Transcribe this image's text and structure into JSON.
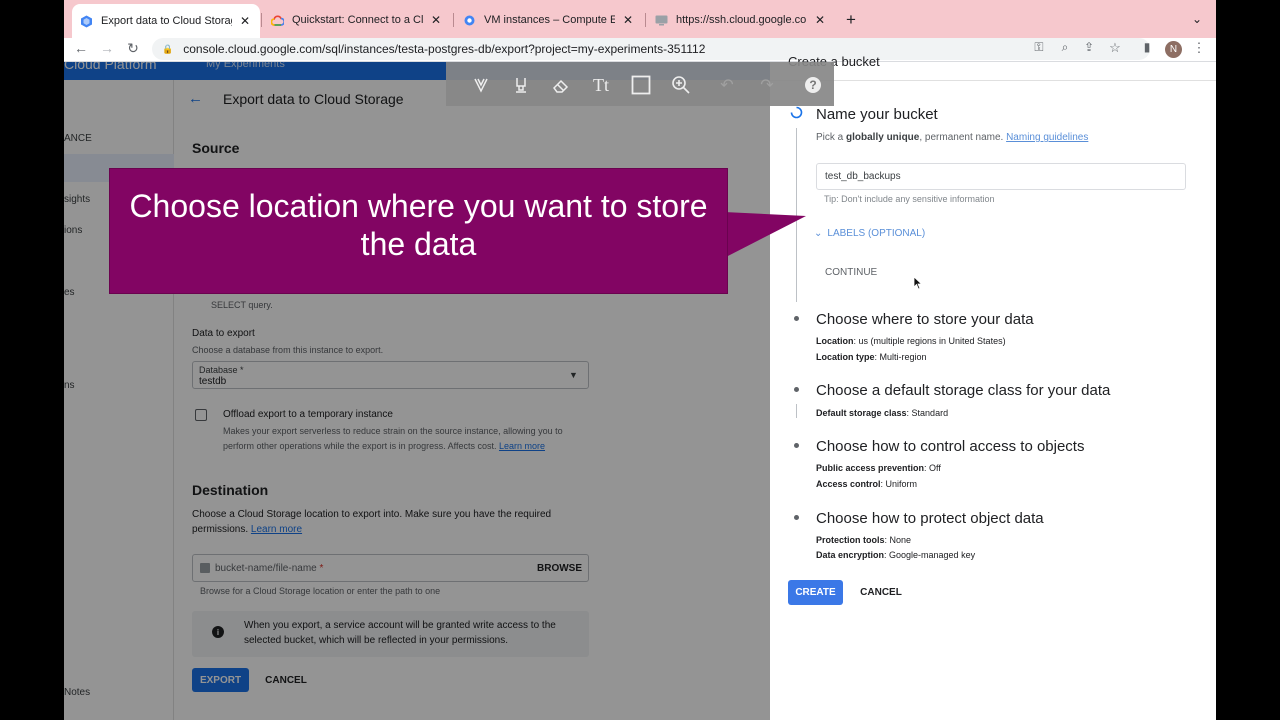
{
  "browser": {
    "tabs": [
      {
        "title": "Export data to Cloud Storage –",
        "icon": "cloud-sql-icon",
        "active": true
      },
      {
        "title": "Quickstart: Connect to a Cloud",
        "icon": "google-cloud-icon",
        "active": false
      },
      {
        "title": "VM instances – Compute Engi",
        "icon": "compute-engine-icon",
        "active": false
      },
      {
        "title": "https://ssh.cloud.google.com/v",
        "icon": "ssh-icon",
        "active": false
      }
    ],
    "new_tab": "+",
    "url": "console.cloud.google.com/sql/instances/testa-postgres-db/export?project=my-experiments-351112",
    "profile_initial": "N"
  },
  "left": {
    "page_title": "Export data to Cloud Storage",
    "header_brand": "Cloud Platform",
    "header_project": "My Experiments",
    "sidenav": [
      "ANCE",
      "sights",
      "ions",
      "es",
      "ns",
      "Notes"
    ],
    "source_heading": "Source",
    "select_query_note": "SELECT query.",
    "data_to_export_label": "Data to export",
    "data_to_export_help": "Choose a database from this instance to export.",
    "database_label": "Database *",
    "database_value": "testdb",
    "offload_label": "Offload export to a temporary instance",
    "offload_help": "Makes your export serverless to reduce strain on the source instance, allowing you to",
    "offload_help2": "perform other operations while the export is in progress. Affects cost.",
    "learn_more": "Learn more",
    "destination_heading": "Destination",
    "destination_help": "Choose a Cloud Storage location to export into. Make sure you have the required",
    "destination_help2": "permissions.",
    "bucket_placeholder": "bucket-name/file-name",
    "browse_label": "BROWSE",
    "bucket_help": "Browse for a Cloud Storage location or enter the path to one",
    "info_text": "When you export, a service account will be granted write access to the",
    "info_text2": "selected bucket, which will be reflected in your permissions.",
    "export_button": "EXPORT",
    "cancel_button": "CANCEL"
  },
  "callout": {
    "line1": "Choose location where you want to store",
    "line2": "the data"
  },
  "right": {
    "panel_title": "Create a bucket",
    "step1_title": "Name your bucket",
    "step1_help_pre": "Pick a ",
    "step1_help_bold": "globally unique",
    "step1_help_post": ", permanent name. ",
    "naming_guidelines": "Naming guidelines",
    "bucket_name": "test_db_backups",
    "tip": "Tip: Don't include any sensitive information",
    "labels_optional": "LABELS (OPTIONAL)",
    "continue": "CONTINUE",
    "step2_title": "Choose where to store your data",
    "location_key": "Location",
    "location_val": ": us (multiple regions in United States)",
    "location_type_key": "Location type",
    "location_type_val": ": Multi-region",
    "step3_title": "Choose a default storage class for your data",
    "storage_class_key": "Default storage class",
    "storage_class_val": ": Standard",
    "step4_title": "Choose how to control access to objects",
    "pap_key": "Public access prevention",
    "pap_val": ": Off",
    "ac_key": "Access control",
    "ac_val": ": Uniform",
    "step5_title": "Choose how to protect object data",
    "prot_key": "Protection tools",
    "prot_val": ": None",
    "enc_key": "Data encryption",
    "enc_val": ": Google-managed key",
    "create": "CREATE",
    "cancel": "CANCEL"
  },
  "colors": {
    "accent": "#1a73e8",
    "callout": "#820563",
    "tabstrip": "#f6c8cd"
  }
}
